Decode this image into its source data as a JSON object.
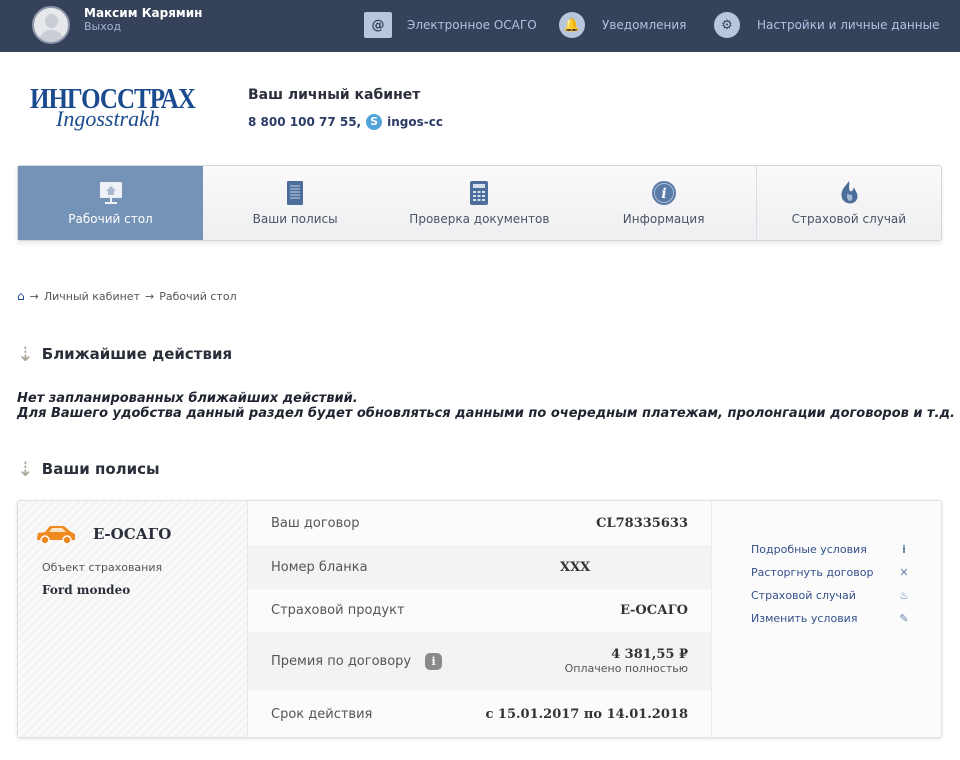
{
  "topbar": {
    "user_name": "Максим Карямин",
    "logout": "Выход",
    "links": [
      {
        "label": "Электронное ОСАГО",
        "icon": "envelope-icon"
      },
      {
        "label": "Уведомления",
        "icon": "bell-icon"
      },
      {
        "label": "Настройки и личные данные",
        "icon": "gear-icon"
      }
    ]
  },
  "header": {
    "logo_ru": "ИНГОССТРАХ",
    "logo_en": "Ingosstrakh",
    "title": "Ваш личный кабинет",
    "phone": "8 800 100 77 55,",
    "skype": "ingos-cc"
  },
  "nav": [
    {
      "label": "Рабочий стол",
      "icon": "monitor-home-icon",
      "active": true
    },
    {
      "label": "Ваши полисы",
      "icon": "document-icon"
    },
    {
      "label": "Проверка документов",
      "icon": "calculator-icon"
    },
    {
      "label": "Информация",
      "icon": "info-icon"
    },
    {
      "label": "Страховой случай",
      "icon": "flame-icon"
    }
  ],
  "breadcrumb": [
    "Личный кабинет",
    "Рабочий стол"
  ],
  "nearest": {
    "title": "Ближайшие действия",
    "line1": "Нет запланированных ближайших действий.",
    "line2": "Для Вашего удобства данный раздел будет обновляться данными по очередным платежам, пролонгации договоров и т.д."
  },
  "policies": {
    "title": "Ваши полисы",
    "card": {
      "product": "Е-ОСАГО",
      "object_label": "Объект страхования",
      "object_value": "Ford mondeo",
      "rows": [
        {
          "label": "Ваш договор",
          "value": "CL78335633"
        },
        {
          "label": "Номер бланка",
          "value": "XXX"
        },
        {
          "label": "Страховой продукт",
          "value": "Е-ОСАГО"
        },
        {
          "label": "Премия по договору",
          "value": "4 381,55 ₽",
          "sub": "Оплачено полностью"
        },
        {
          "label": "Срок действия",
          "value": "с 15.01.2017 по 14.01.2018"
        }
      ],
      "actions": [
        {
          "label": "Подробные условия",
          "icon": "info-icon"
        },
        {
          "label": "Расторгнуть договор",
          "icon": "close-icon"
        },
        {
          "label": "Страховой случай",
          "icon": "flame-icon"
        },
        {
          "label": "Изменить условия",
          "icon": "pencil-icon"
        }
      ]
    }
  }
}
